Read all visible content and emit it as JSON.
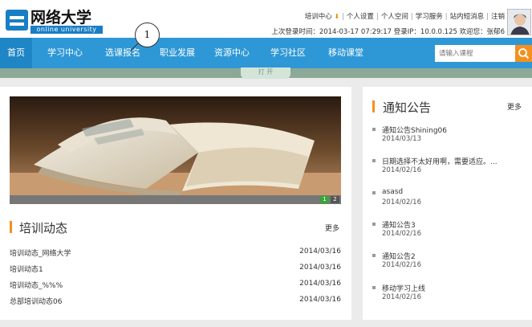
{
  "logo": {
    "title": "网络大学",
    "subtitle": "online university"
  },
  "top_links": {
    "training_center": "培训中心",
    "personal_settings": "个人设置",
    "personal_space": "个人空间",
    "learning_service": "学习服务",
    "sms": "站内短消息",
    "logout": "注销"
  },
  "login_info": "上次登录时间：2014-03-17 07:29:17  登录IP：10.0.0.125  欢迎您：张郁6",
  "nav": {
    "items": [
      "首页",
      "学习中心",
      "选课报名",
      "职业发展",
      "资源中心",
      "学习社区",
      "移动课堂"
    ],
    "active_index": 0
  },
  "search": {
    "placeholder": "请输入课程"
  },
  "toggle_label": "打 开",
  "callout_number": "1",
  "banner": {
    "slides": [
      "1",
      "2"
    ],
    "active_slide": 1
  },
  "training": {
    "title": "培训动态",
    "more": "更多",
    "items": [
      {
        "title": "培训动态_网络大学",
        "date": "2014/03/16"
      },
      {
        "title": "培训动态1",
        "date": "2014/03/16"
      },
      {
        "title": "培训动态_%%%",
        "date": "2014/03/16"
      },
      {
        "title": "总部培训动态06",
        "date": "2014/03/16"
      }
    ]
  },
  "notices": {
    "title": "通知公告",
    "more": "更多",
    "items": [
      {
        "title": "通知公告Shining06",
        "date": "2014/03/13"
      },
      {
        "title": "日期选择不太好用啊，需要适应。...",
        "date": "2014/02/16"
      },
      {
        "title": "asasd",
        "date": "2014/02/16"
      },
      {
        "title": "通知公告3",
        "date": "2014/02/16"
      },
      {
        "title": "通知公告2",
        "date": "2014/02/16"
      },
      {
        "title": "移动学习上线",
        "date": "2014/02/16"
      }
    ]
  },
  "colors": {
    "nav_bg": "#2e98d6",
    "accent_orange": "#f4901e",
    "brand_blue": "#1a7ec4"
  }
}
